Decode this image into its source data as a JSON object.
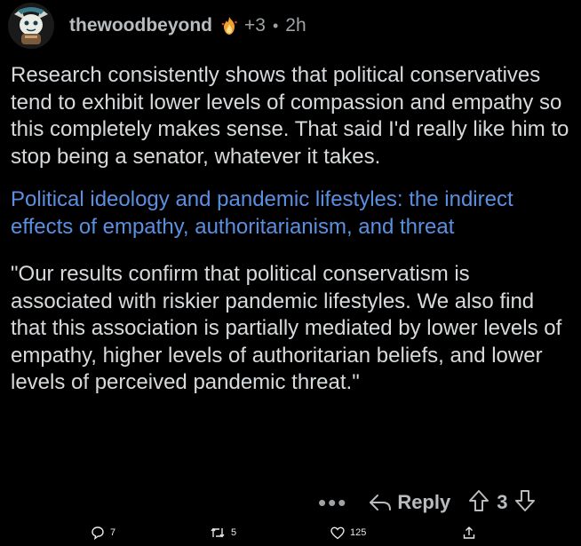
{
  "comment": {
    "username": "thewoodbeyond",
    "award_count": "+3",
    "separator": "•",
    "time": "2h",
    "paragraph1": "Research consistently shows that political conservatives tend to exhibit lower levels of compassion and empathy so this completely makes sense. That said I'd really like him to stop being a senator, whatever it takes.",
    "link_text": "Political ideology and pandemic lifestyles: the indirect effects of empathy, authoritarianism, and threat",
    "quote": "\"Our results confirm that political conservatism is associated with riskier pandemic lifestyles. We also find that this association is partially mediated by lower levels of empathy, higher levels of authoritarian beliefs, and lower levels of perceived pandemic threat.\""
  },
  "actions": {
    "more": "•••",
    "reply_label": "Reply",
    "score": "3"
  },
  "bottom_bar": {
    "replies": "7",
    "reposts": "5",
    "likes": "125"
  },
  "colors": {
    "background": "#000000",
    "text": "#d7dadc",
    "link": "#5b8fe0",
    "meta": "#9ea3a6",
    "award": "#f0a030"
  },
  "icons": {
    "avatar": "avatar-icon",
    "award": "flame-award-icon",
    "reply": "reply-arrow-icon",
    "upvote": "upvote-arrow-icon",
    "downvote": "downvote-arrow-icon",
    "comment": "comment-bubble-icon",
    "repost": "repost-icon",
    "like": "heart-icon",
    "share": "share-icon"
  }
}
